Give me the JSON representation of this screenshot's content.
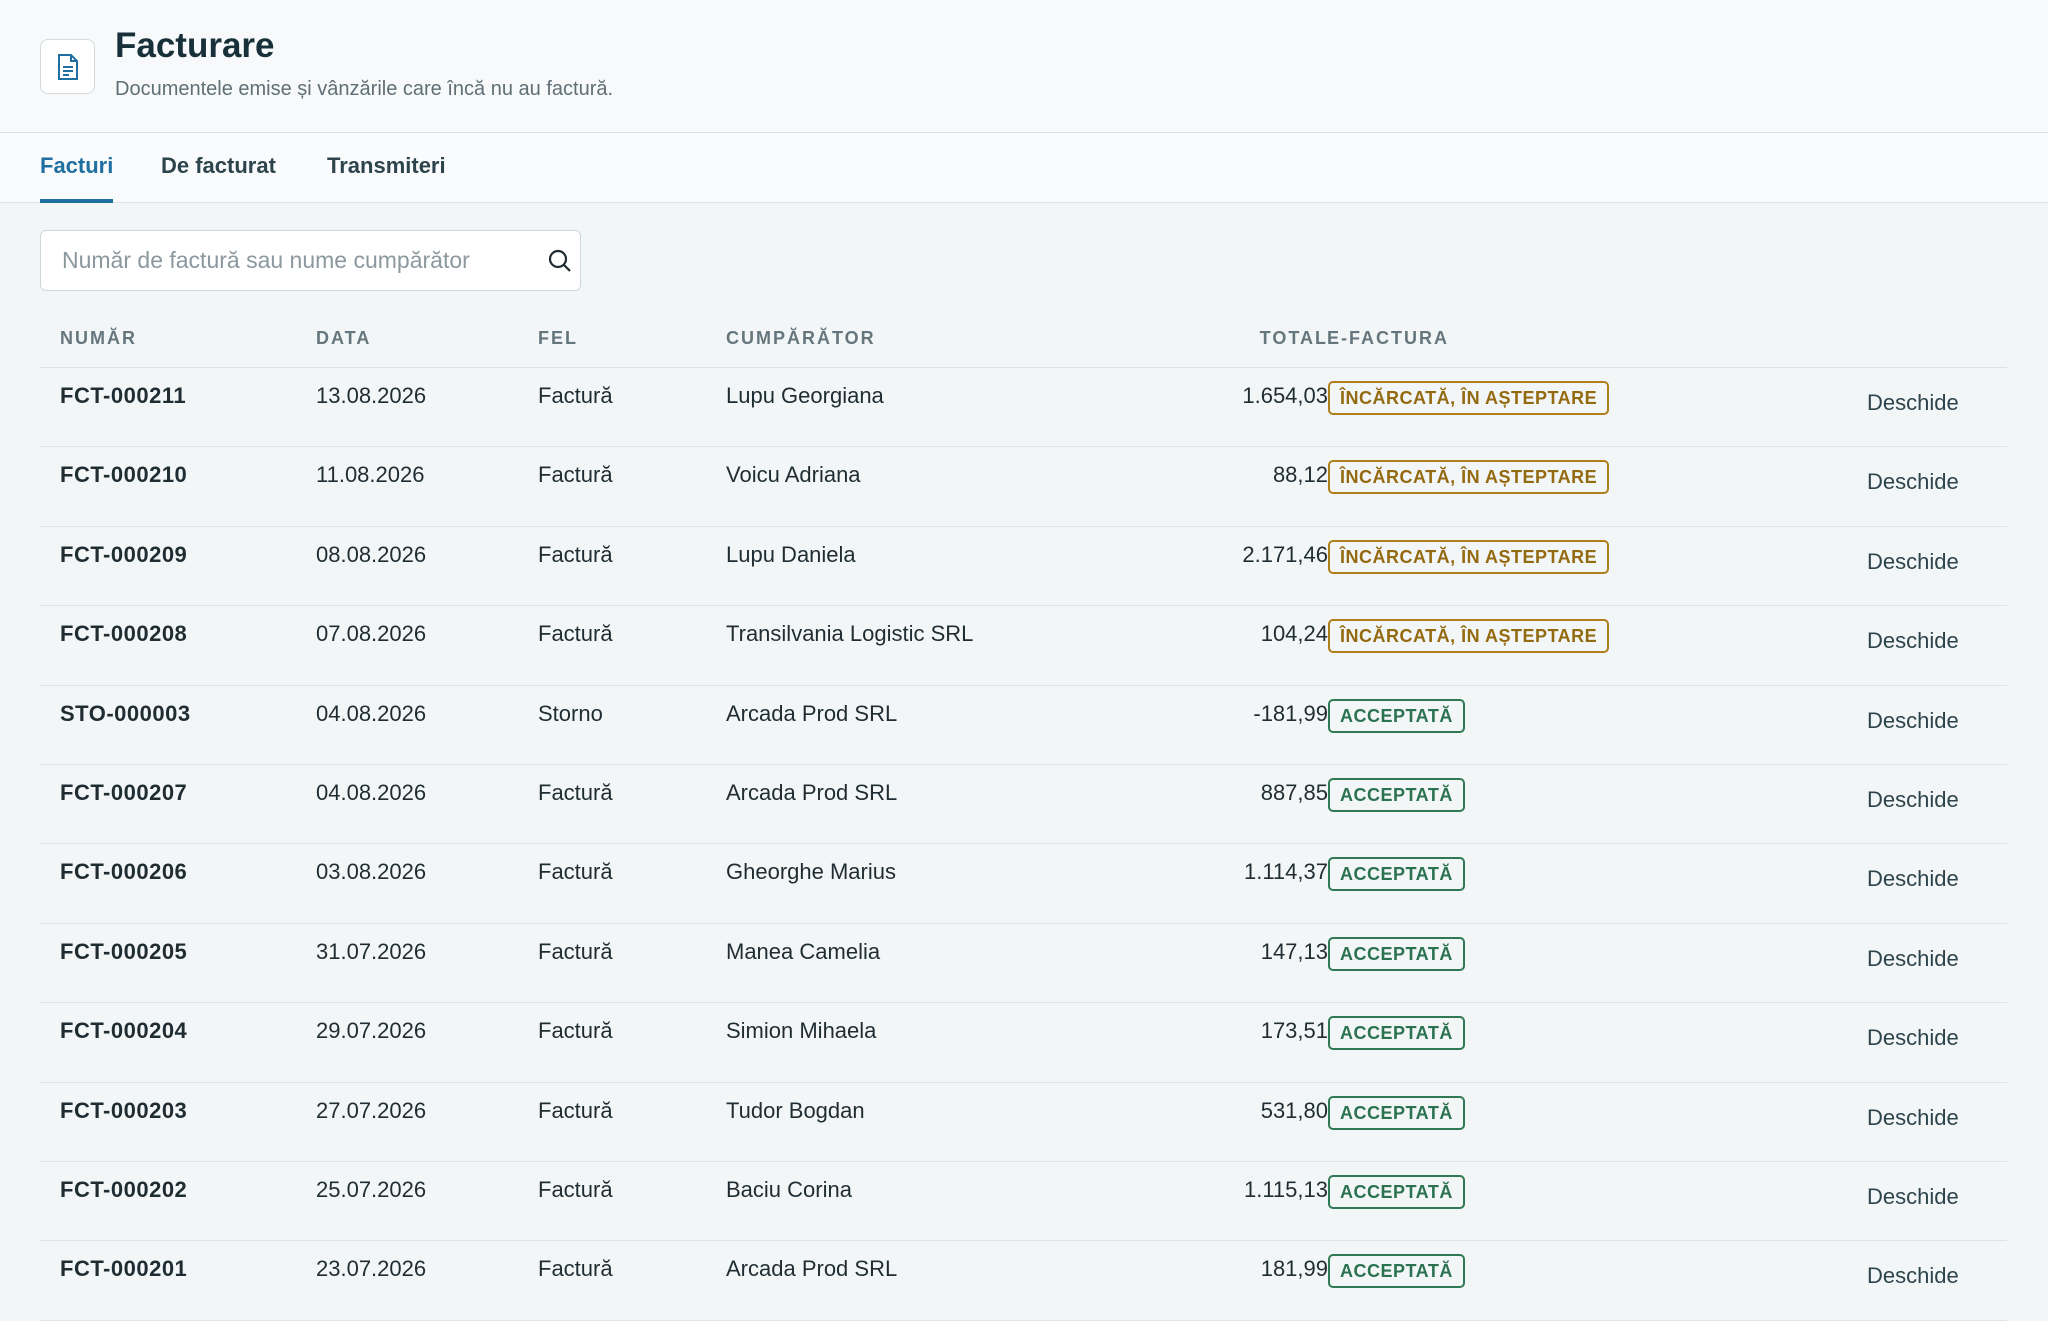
{
  "header": {
    "title": "Facturare",
    "subtitle": "Documentele emise și vânzările care încă nu au factură.",
    "icon": "document-icon"
  },
  "tabs": [
    {
      "label": "Facturi",
      "active": true
    },
    {
      "label": "De facturat",
      "active": false
    },
    {
      "label": "Transmiteri",
      "active": false
    }
  ],
  "search": {
    "placeholder": "Număr de factură sau nume cumpărător",
    "value": "",
    "icon": "search-icon"
  },
  "colors": {
    "accent": "#1f6fa0",
    "pending": "#946a10",
    "accepted": "#2b7250"
  },
  "table": {
    "columns": [
      "NUMĂR",
      "DATA",
      "FEL",
      "CUMPĂRĂTOR",
      "TOTAL",
      "E-FACTURA"
    ],
    "action_label": "Deschide",
    "rows": [
      {
        "number": "FCT-000211",
        "date": "13.08.2026",
        "kind": "Factură",
        "buyer": "Lupu Georgiana",
        "total": "1.654,03",
        "status": "ÎNCĂRCATĂ, ÎN AȘTEPTARE",
        "status_type": "pending"
      },
      {
        "number": "FCT-000210",
        "date": "11.08.2026",
        "kind": "Factură",
        "buyer": "Voicu Adriana",
        "total": "88,12",
        "status": "ÎNCĂRCATĂ, ÎN AȘTEPTARE",
        "status_type": "pending"
      },
      {
        "number": "FCT-000209",
        "date": "08.08.2026",
        "kind": "Factură",
        "buyer": "Lupu Daniela",
        "total": "2.171,46",
        "status": "ÎNCĂRCATĂ, ÎN AȘTEPTARE",
        "status_type": "pending"
      },
      {
        "number": "FCT-000208",
        "date": "07.08.2026",
        "kind": "Factură",
        "buyer": "Transilvania Logistic SRL",
        "total": "104,24",
        "status": "ÎNCĂRCATĂ, ÎN AȘTEPTARE",
        "status_type": "pending"
      },
      {
        "number": "STO-000003",
        "date": "04.08.2026",
        "kind": "Storno",
        "buyer": "Arcada Prod SRL",
        "total": "-181,99",
        "status": "ACCEPTATĂ",
        "status_type": "accepted"
      },
      {
        "number": "FCT-000207",
        "date": "04.08.2026",
        "kind": "Factură",
        "buyer": "Arcada Prod SRL",
        "total": "887,85",
        "status": "ACCEPTATĂ",
        "status_type": "accepted"
      },
      {
        "number": "FCT-000206",
        "date": "03.08.2026",
        "kind": "Factură",
        "buyer": "Gheorghe Marius",
        "total": "1.114,37",
        "status": "ACCEPTATĂ",
        "status_type": "accepted"
      },
      {
        "number": "FCT-000205",
        "date": "31.07.2026",
        "kind": "Factură",
        "buyer": "Manea Camelia",
        "total": "147,13",
        "status": "ACCEPTATĂ",
        "status_type": "accepted"
      },
      {
        "number": "FCT-000204",
        "date": "29.07.2026",
        "kind": "Factură",
        "buyer": "Simion Mihaela",
        "total": "173,51",
        "status": "ACCEPTATĂ",
        "status_type": "accepted"
      },
      {
        "number": "FCT-000203",
        "date": "27.07.2026",
        "kind": "Factură",
        "buyer": "Tudor Bogdan",
        "total": "531,80",
        "status": "ACCEPTATĂ",
        "status_type": "accepted"
      },
      {
        "number": "FCT-000202",
        "date": "25.07.2026",
        "kind": "Factură",
        "buyer": "Baciu Corina",
        "total": "1.115,13",
        "status": "ACCEPTATĂ",
        "status_type": "accepted"
      },
      {
        "number": "FCT-000201",
        "date": "23.07.2026",
        "kind": "Factură",
        "buyer": "Arcada Prod SRL",
        "total": "181,99",
        "status": "ACCEPTATĂ",
        "status_type": "accepted"
      }
    ]
  }
}
